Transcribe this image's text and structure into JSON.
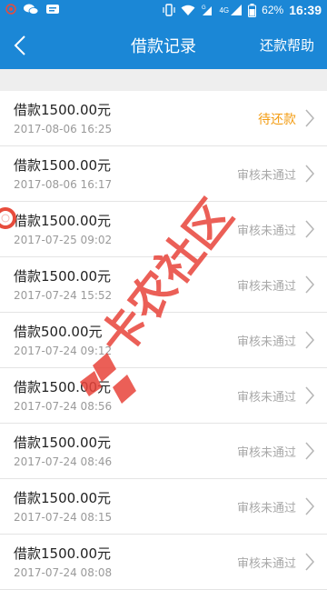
{
  "status_bar": {
    "battery": "62%",
    "network": "4G",
    "time": "16:39"
  },
  "header": {
    "title": "借款记录",
    "help": "还款帮助"
  },
  "records": [
    {
      "amount": "借款1500.00元",
      "time": "2017-08-06 16:25",
      "status": "待还款",
      "pending": true
    },
    {
      "amount": "借款1500.00元",
      "time": "2017-08-06 16:17",
      "status": "审核未通过",
      "pending": false
    },
    {
      "amount": "借款1500.00元",
      "time": "2017-07-25 09:02",
      "status": "审核未通过",
      "pending": false
    },
    {
      "amount": "借款1500.00元",
      "time": "2017-07-24 15:52",
      "status": "审核未通过",
      "pending": false
    },
    {
      "amount": "借款500.00元",
      "time": "2017-07-24 09:12",
      "status": "审核未通过",
      "pending": false
    },
    {
      "amount": "借款1500.00元",
      "time": "2017-07-24 08:56",
      "status": "审核未通过",
      "pending": false
    },
    {
      "amount": "借款1500.00元",
      "time": "2017-07-24 08:46",
      "status": "审核未通过",
      "pending": false
    },
    {
      "amount": "借款1500.00元",
      "time": "2017-07-24 08:15",
      "status": "审核未通过",
      "pending": false
    },
    {
      "amount": "借款1500.00元",
      "time": "2017-07-24 08:08",
      "status": "审核未通过",
      "pending": false
    }
  ],
  "watermark": "卡农社区",
  "colors": {
    "primary": "#1b87d6",
    "pending": "#f39c12",
    "watermark": "#e8433a"
  }
}
